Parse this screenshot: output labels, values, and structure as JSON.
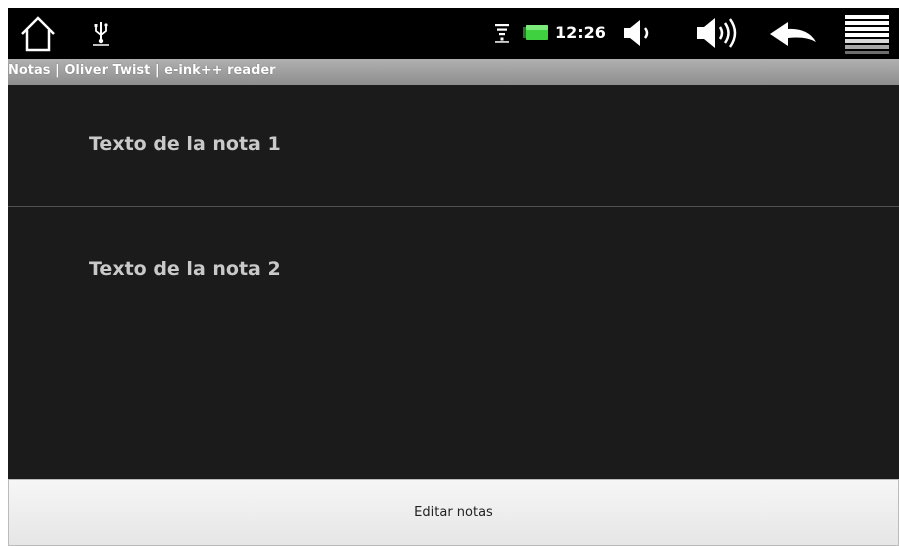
{
  "status_bar": {
    "time": "12:26",
    "icons": [
      "home-icon",
      "usb-icon",
      "wifi-icon",
      "battery-icon",
      "volume-down-icon",
      "volume-up-icon",
      "back-icon",
      "menu-icon"
    ]
  },
  "title_bar": {
    "title": "Notas | Oliver Twist | e-ink++ reader"
  },
  "notes": {
    "items": [
      {
        "text": "Texto de la nota 1"
      },
      {
        "text": "Texto de la nota 2"
      }
    ]
  },
  "footer": {
    "edit_label": "Editar notas"
  },
  "colors": {
    "background": "#1b1b1b",
    "status_bar": "#000000",
    "title_bar": "#9e9e9e",
    "note_text": "#c9c9c9",
    "battery": "#3fd13f"
  }
}
